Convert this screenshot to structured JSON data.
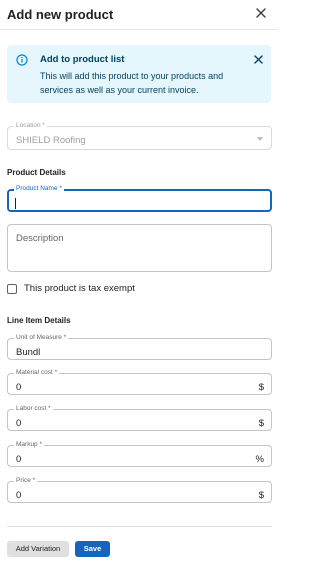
{
  "dialog": {
    "title": "Add new product"
  },
  "alert": {
    "title": "Add to product list",
    "body": "This will add this product to your products and services as well as your current invoice."
  },
  "location": {
    "label": "Location *",
    "value": "SHIELD Roofing"
  },
  "sections": {
    "product_details": "Product Details",
    "line_item_details": "Line Item Details"
  },
  "product_name": {
    "label": "Product Name *",
    "value": ""
  },
  "description": {
    "placeholder": "Description"
  },
  "tax_exempt": {
    "label": "This product is tax exempt",
    "checked": false
  },
  "unit_of_measure": {
    "label": "Unit of Measure *",
    "value": "Bundl"
  },
  "material_cost": {
    "label": "Material cost *",
    "value": "0",
    "suffix": "$"
  },
  "labor_cost": {
    "label": "Labor cost *",
    "value": "0",
    "suffix": "$"
  },
  "markup": {
    "label": "Markup *",
    "value": "0",
    "suffix": "%"
  },
  "price": {
    "label": "Price *",
    "value": "0",
    "suffix": "$"
  },
  "actions": {
    "add_variation": "Add Variation",
    "save": "Save"
  },
  "colors": {
    "primary": "#1565c0",
    "alert_bg": "#e5f6fd",
    "alert_text": "#014361"
  },
  "icons": {
    "close": "close-icon",
    "info": "info-icon",
    "alert_close": "close-icon",
    "dropdown": "chevron-down-icon"
  }
}
